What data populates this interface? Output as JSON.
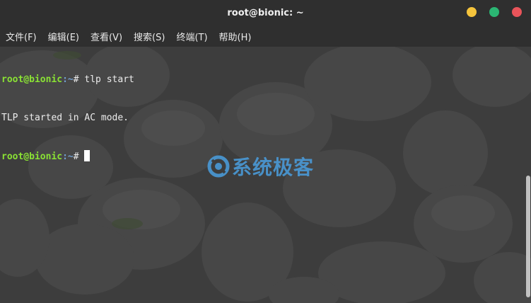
{
  "window": {
    "title": "root@bionic: ~"
  },
  "menu": [
    {
      "label": "文件(F)"
    },
    {
      "label": "编辑(E)"
    },
    {
      "label": "查看(V)"
    },
    {
      "label": "搜索(S)"
    },
    {
      "label": "终端(T)"
    },
    {
      "label": "帮助(H)"
    }
  ],
  "terminal": {
    "prompt_user": "root@bionic",
    "prompt_path": ":~",
    "prompt_symbol": "#",
    "command": " tlp start",
    "output": "TLP started in AC mode."
  },
  "watermark": {
    "text": "系统极客"
  },
  "colors": {
    "prompt_user": "#8ae234",
    "prompt_path": "#729fcf",
    "watermark": "#4a9fe0"
  },
  "icons": {
    "minimize": "minimize-icon",
    "maximize": "maximize-icon",
    "close": "close-icon",
    "watermark": "watermark-logo-icon"
  }
}
